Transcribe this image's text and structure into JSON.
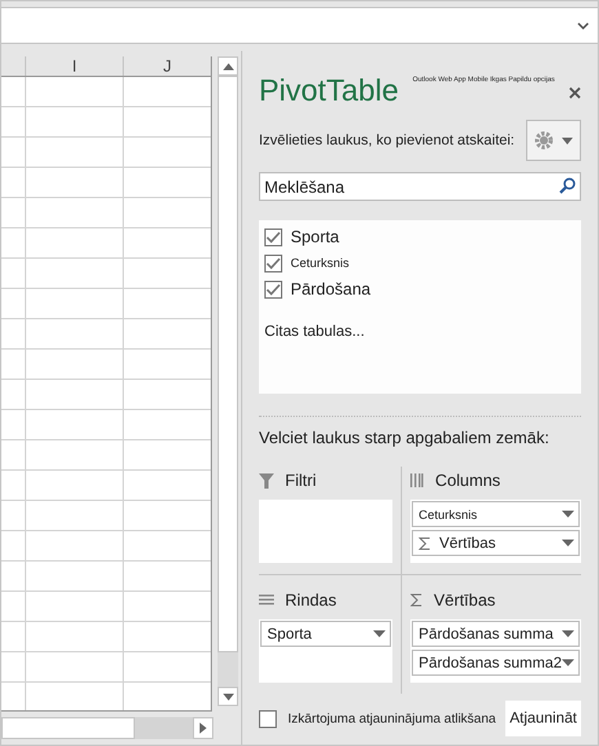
{
  "sheet": {
    "columns": [
      {},
      {
        "label": "I"
      },
      {
        "label": "J"
      }
    ]
  },
  "pane": {
    "title": "PivotTable",
    "tiny_menu": "Outlook Web App Mobile Ikgas Papildu opcijas",
    "choose_label": "Izvēlieties laukus, ko pievienot atskaitei:",
    "search": {
      "placeholder": "Meklēšana"
    },
    "fields": [
      {
        "label": "Sporta",
        "checked": true,
        "small": false
      },
      {
        "label": "Ceturksnis",
        "checked": true,
        "small": true
      },
      {
        "label": "Pārdošana",
        "checked": true,
        "small": false
      }
    ],
    "more_tables": "Citas tabulas...",
    "drag_label": "Velciet laukus starp apgabaliem zemāk:",
    "areas": [
      {
        "kind": "filter",
        "title": "Filtri"
      },
      {
        "kind": "columns",
        "title": "Columns",
        "items": [
          {
            "label": "Ceturksnis",
            "sigma": false,
            "small": true
          },
          {
            "label": "Vērtības",
            "sigma": true,
            "small": false
          }
        ]
      },
      {
        "kind": "rows",
        "title": "Rindas",
        "items": [
          {
            "label": "Sporta",
            "sigma": false,
            "small": false
          }
        ]
      },
      {
        "kind": "values",
        "title": "Vērtības",
        "items": [
          {
            "label": "Pārdošanas summa",
            "sigma": false,
            "small": false
          },
          {
            "label": "Pārdošanas summa2",
            "sigma": false,
            "small": false
          }
        ]
      }
    ],
    "defer": {
      "label": "Izkārtojuma atjauninājuma atlikšana",
      "checked": false
    },
    "update_button": "Atjaunināt"
  }
}
